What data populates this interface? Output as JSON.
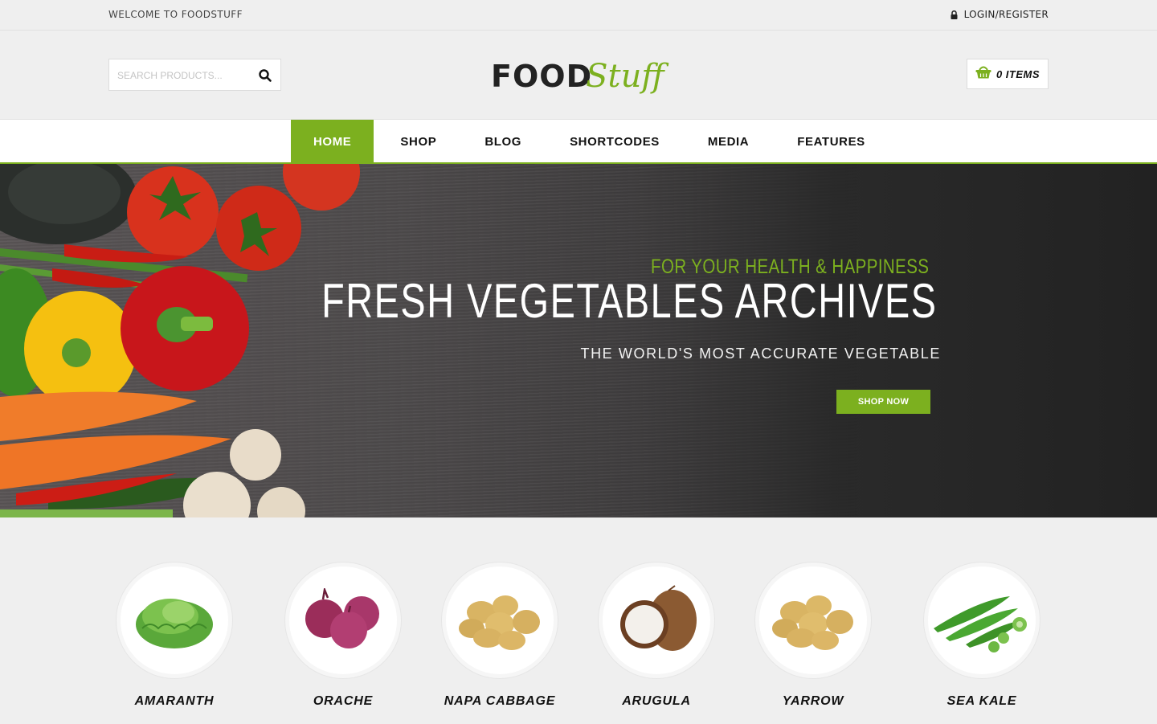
{
  "topbar": {
    "welcome": "WELCOME TO FOODSTUFF",
    "login_label": "LOGIN/REGISTER",
    "login_icon": "lock-icon"
  },
  "header": {
    "search": {
      "placeholder": "SEARCH PRODUCTS...",
      "value": "",
      "icon": "search-icon"
    },
    "logo": {
      "part1": "FOOD",
      "part2": "Stuff"
    },
    "cart": {
      "label": "0 ITEMS",
      "count": 0,
      "icon": "basket-icon"
    }
  },
  "nav": {
    "items": [
      {
        "label": "HOME",
        "active": true
      },
      {
        "label": "SHOP",
        "active": false
      },
      {
        "label": "BLOG",
        "active": false
      },
      {
        "label": "SHORTCODES",
        "active": false
      },
      {
        "label": "MEDIA",
        "active": false
      },
      {
        "label": "FEATURES",
        "active": false
      }
    ]
  },
  "hero": {
    "tagline": "FOR YOUR HEALTH & HAPPINESS",
    "title": "FRESH VEGETABLES ARCHIVES",
    "subtitle": "THE WORLD'S MOST ACCURATE VEGETABLE",
    "button": "SHOP NOW"
  },
  "categories": [
    {
      "name": "AMARANTH",
      "image": "lettuce"
    },
    {
      "name": "ORACHE",
      "image": "red-onions"
    },
    {
      "name": "NAPA CABBAGE",
      "image": "potatoes"
    },
    {
      "name": "ARUGULA",
      "image": "coconut"
    },
    {
      "name": "YARROW",
      "image": "potatoes"
    },
    {
      "name": "SEA KALE",
      "image": "okra"
    }
  ],
  "colors": {
    "accent": "#7cb01f",
    "background": "#efefef",
    "dark": "#222222"
  }
}
